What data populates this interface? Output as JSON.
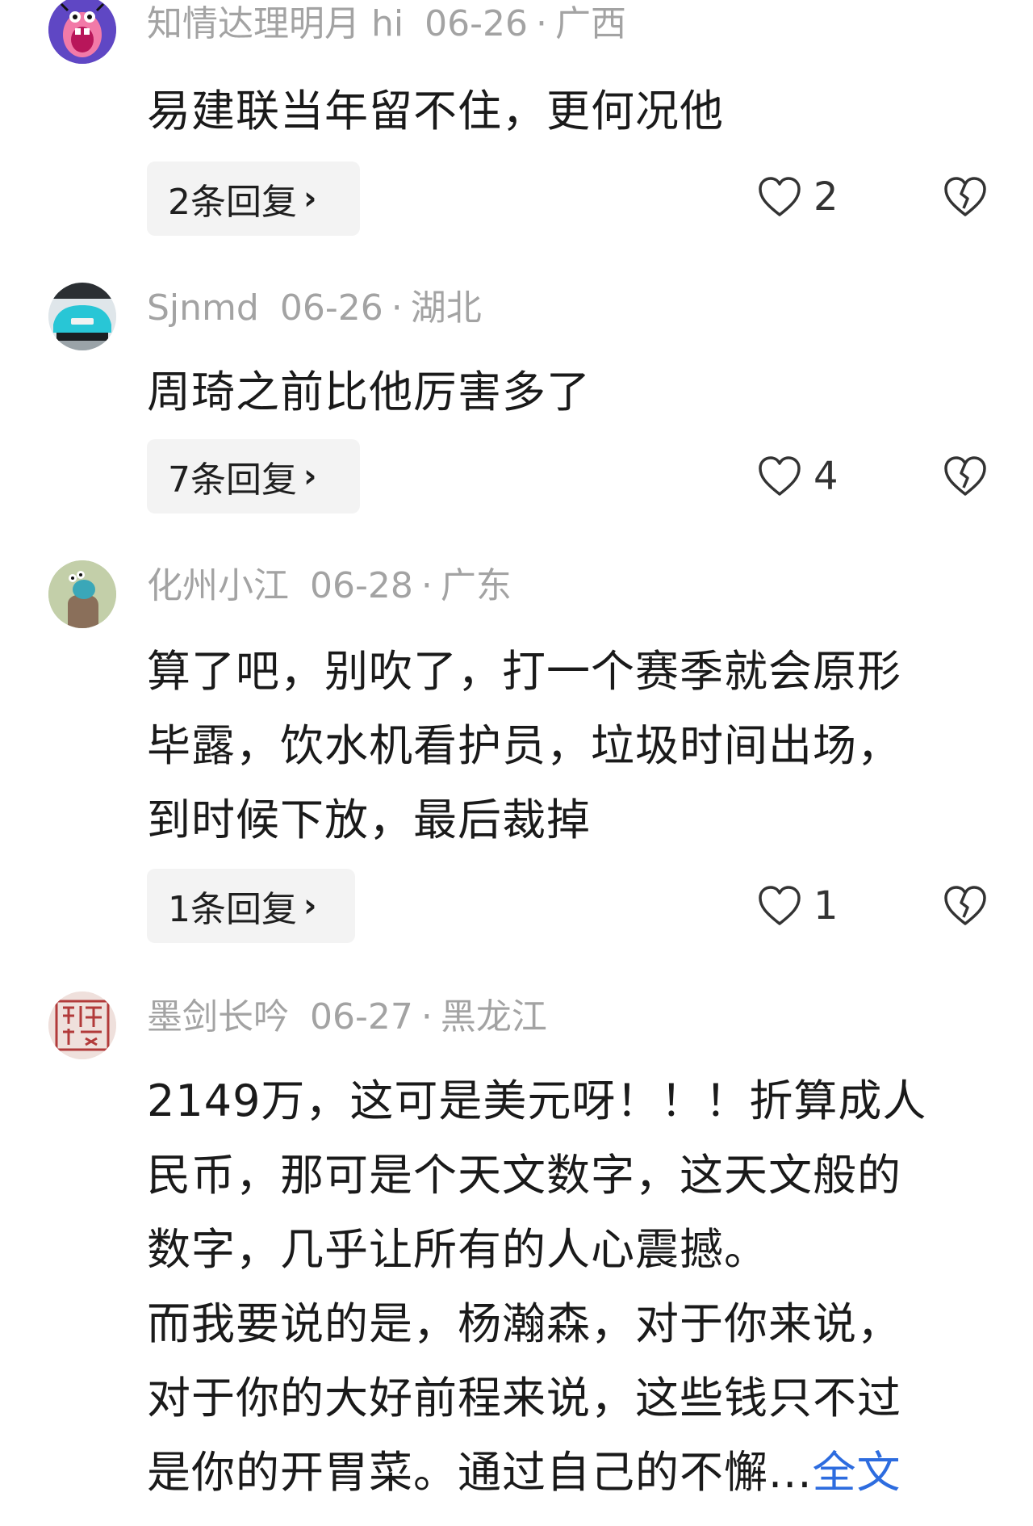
{
  "comments": [
    {
      "username": "知情达理明月 hi",
      "date": "06-26",
      "separator": "·",
      "region": "广西",
      "avatar_icon": "screaming-cartoon-face",
      "lines": [
        "易建联当年留不住，更何况他"
      ],
      "reply_label": "2条回复",
      "likes": "2"
    },
    {
      "username": "Sjnmd",
      "date": "06-26",
      "separator": "·",
      "region": "湖北",
      "avatar_icon": "teal-car",
      "lines": [
        "周琦之前比他厉害多了"
      ],
      "reply_label": "7条回复",
      "likes": "4"
    },
    {
      "username": "化州小江",
      "date": "06-28",
      "separator": "·",
      "region": "广东",
      "avatar_icon": "snail-character",
      "lines": [
        "算了吧，别吹了，打一个赛季就会原形",
        "毕露，饮水机看护员，垃圾时间出场，",
        "到时候下放，最后裁掉"
      ],
      "reply_label": "1条回复",
      "likes": "1"
    },
    {
      "username": "墨剑长吟",
      "date": "06-27",
      "separator": "·",
      "region": "黑龙江",
      "avatar_icon": "red-seal-stamp",
      "lines": [
        "2149万，这可是美元呀！！！折算成人",
        "民币，那可是个天文数字，这天文般的",
        "数字，几乎让所有的人心震撼。",
        "而我要说的是，杨瀚森，对于你来说，",
        "对于你的大好前程来说，这些钱只不过",
        "是你的开胃菜。通过自己的不懈..."
      ],
      "more_label": "全文"
    }
  ],
  "colors": {
    "meta_text": "#a3a3a3",
    "link": "#2d6cdf",
    "reply_bg": "#f3f3f3"
  },
  "icons": {
    "chevron": "›",
    "like": "heart-outline-icon",
    "dislike": "broken-heart-icon"
  }
}
